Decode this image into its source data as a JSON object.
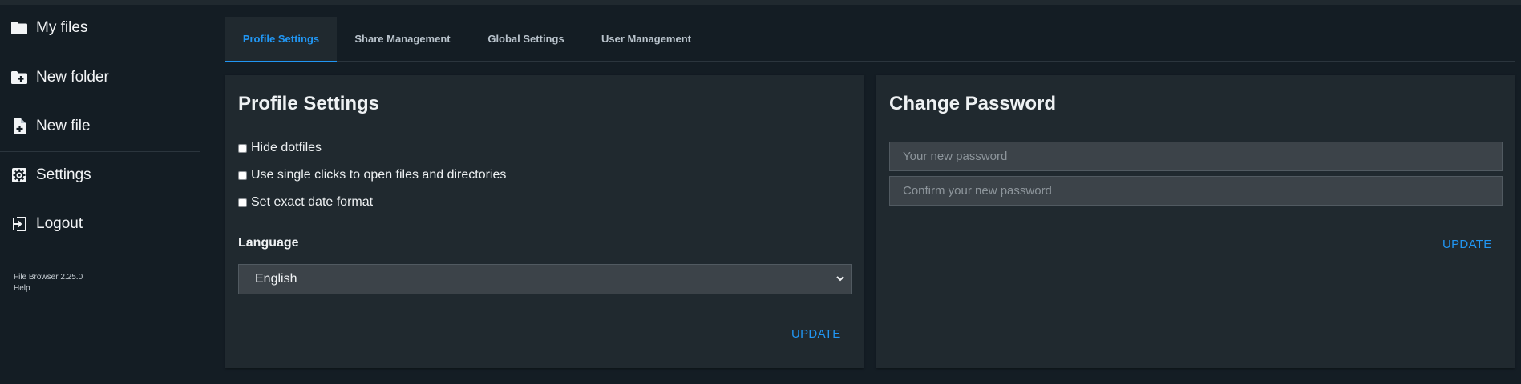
{
  "sidebar": {
    "items": [
      {
        "label": "My files",
        "icon": "folder-icon"
      },
      {
        "label": "New folder",
        "icon": "folder-plus-icon"
      },
      {
        "label": "New file",
        "icon": "file-plus-icon"
      },
      {
        "label": "Settings",
        "icon": "gear-icon"
      },
      {
        "label": "Logout",
        "icon": "logout-icon"
      }
    ],
    "credits": {
      "version": "File Browser 2.25.0",
      "help": "Help"
    }
  },
  "tabs": [
    {
      "label": "Profile Settings",
      "active": true
    },
    {
      "label": "Share Management",
      "active": false
    },
    {
      "label": "Global Settings",
      "active": false
    },
    {
      "label": "User Management",
      "active": false
    }
  ],
  "profile": {
    "title": "Profile Settings",
    "checkboxes": [
      {
        "label": "Hide dotfiles",
        "checked": false
      },
      {
        "label": "Use single clicks to open files and directories",
        "checked": false
      },
      {
        "label": "Set exact date format",
        "checked": false
      }
    ],
    "language_label": "Language",
    "language_value": "English",
    "update_label": "UPDATE"
  },
  "password": {
    "title": "Change Password",
    "new_placeholder": "Your new password",
    "confirm_placeholder": "Confirm your new password",
    "update_label": "UPDATE"
  },
  "colors": {
    "accent": "#2196f3",
    "background": "#141d24",
    "card": "#20292f",
    "input": "#3c4349"
  }
}
